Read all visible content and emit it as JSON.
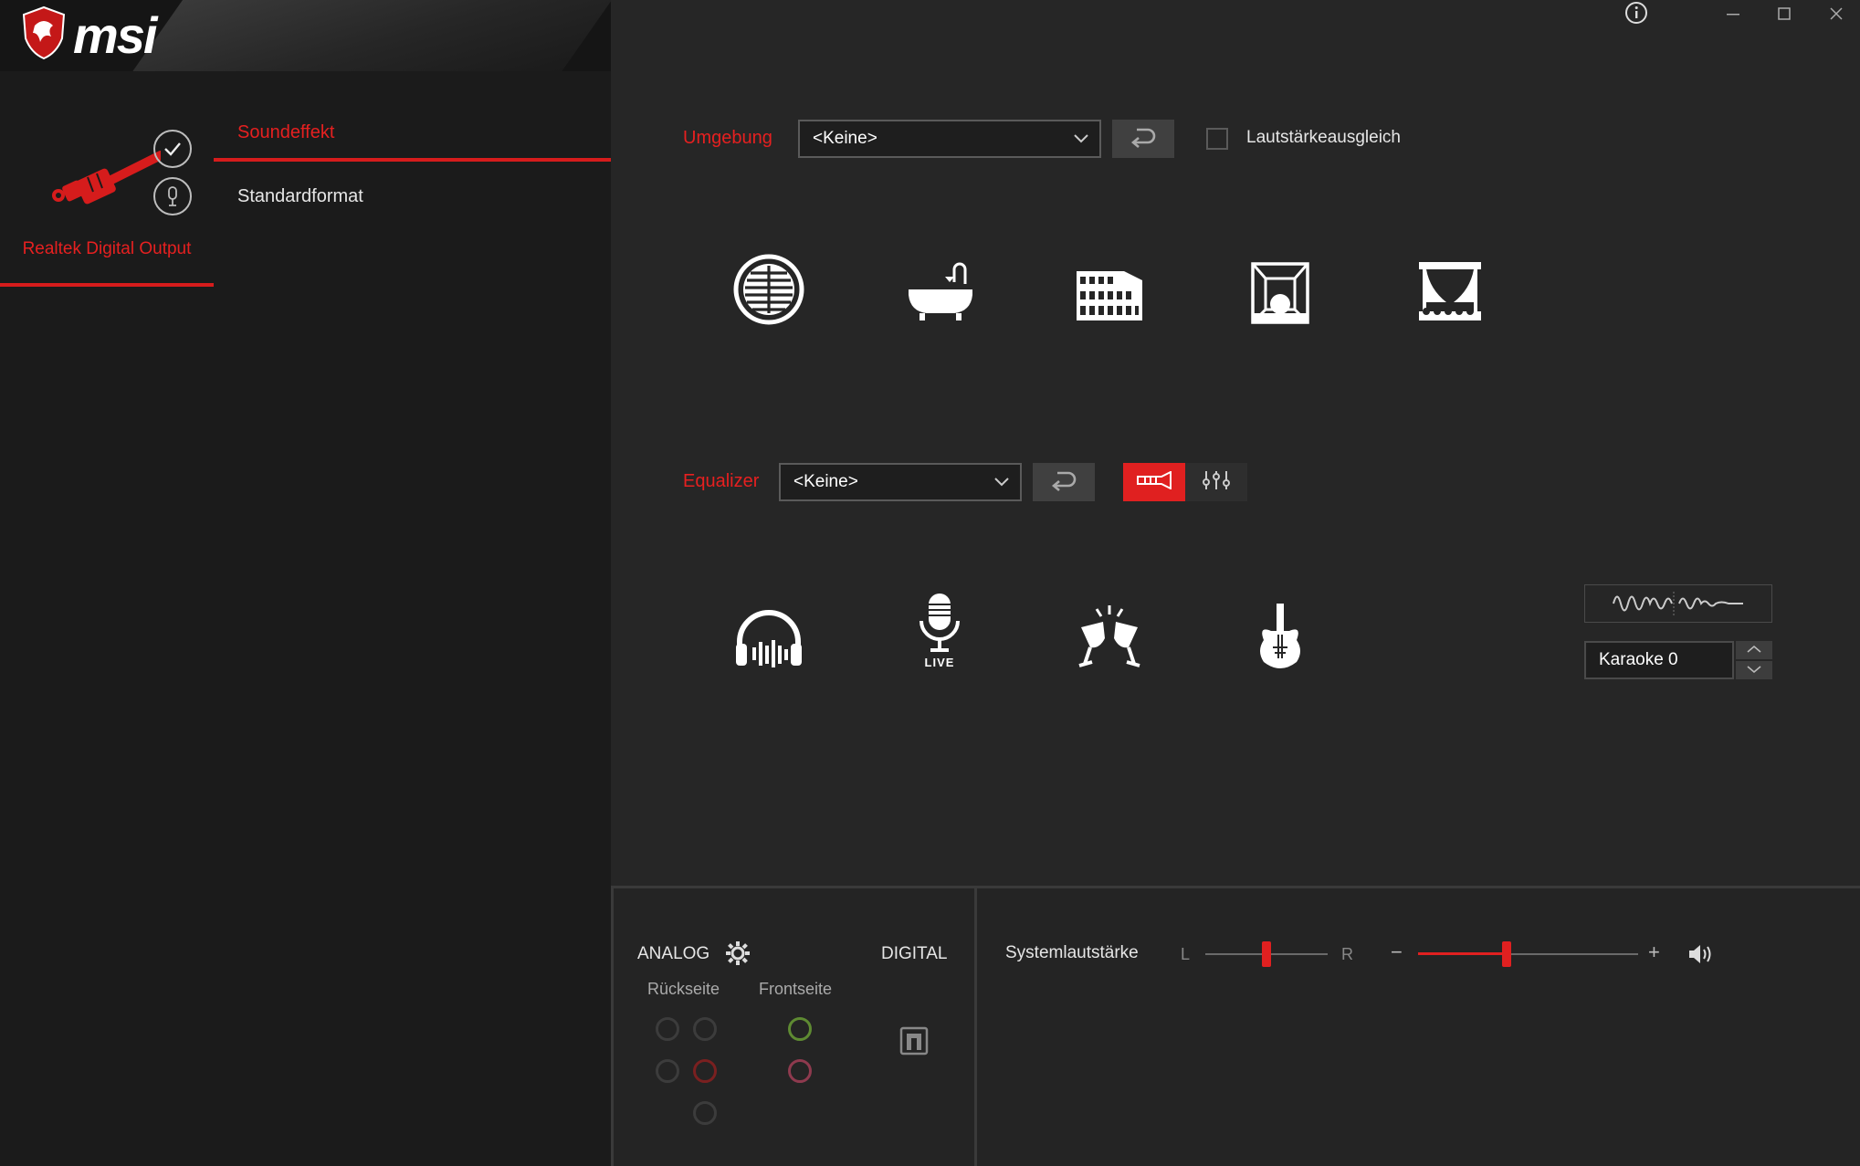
{
  "brand": {
    "name": "msi"
  },
  "window": {
    "info": "ⓘ",
    "minimize": "—",
    "maximize": "☐",
    "close": "✕"
  },
  "device": {
    "label": "Realtek Digital Output"
  },
  "tabs": [
    {
      "label": "Soundeffekt"
    },
    {
      "label": "Standardformat"
    }
  ],
  "environment": {
    "label": "Umgebung",
    "value": "<Keine>",
    "loudness_label": "Lautstärkeausgleich",
    "loudness_checked": false,
    "presets": [
      "sewer-pipe-icon",
      "bathroom-icon",
      "colosseum-icon",
      "stone-room-icon",
      "theater-icon"
    ]
  },
  "equalizer": {
    "label": "Equalizer",
    "value": "<Keine>",
    "presets": [
      "headphones-icon",
      "live-microphone-icon",
      "party-icon",
      "rock-guitar-icon"
    ],
    "live_label": "LIVE"
  },
  "karaoke": {
    "value": "Karaoke 0"
  },
  "connectors": {
    "analog_label": "ANALOG",
    "digital_label": "DIGITAL",
    "rear_label": "Rückseite",
    "front_label": "Frontseite"
  },
  "volume": {
    "label": "Systemlautstärke",
    "left_label": "L",
    "right_label": "R",
    "minus": "−",
    "plus": "+",
    "balance": 0.5,
    "level": 0.4
  },
  "colors": {
    "accent": "#e62020",
    "background": "#262626",
    "sidebar": "#1b1b1b",
    "front_green": "#5e8a32",
    "front_pink": "#8e3a4e",
    "rear_red": "#7a2020"
  }
}
